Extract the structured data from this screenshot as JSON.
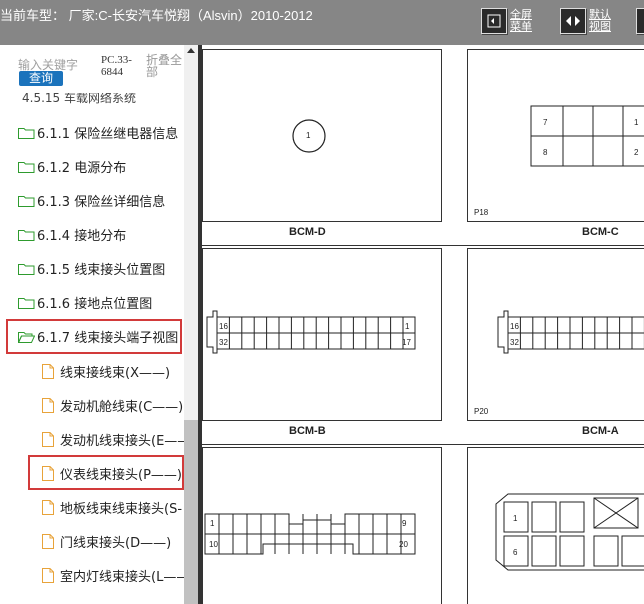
{
  "header": {
    "title": "当前车型：  厂家:C-长安汽车悦翔（Alsvin）2010-2012",
    "fullscreen_label": "全屏菜单",
    "default_view_label": "默认视图"
  },
  "sidebar": {
    "keyword_placeholder": "输入关键字",
    "query_button": "查询",
    "pc_code": "PC.33-6844",
    "collapse_all": "折叠全部",
    "partial_item": "4.5.15 车载网络系统",
    "tree": [
      {
        "label": "6.1.1 保险丝继电器信息",
        "type": "folder"
      },
      {
        "label": "6.1.2 电源分布",
        "type": "folder"
      },
      {
        "label": "6.1.3 保险丝详细信息",
        "type": "folder"
      },
      {
        "label": "6.1.4 接地分布",
        "type": "folder"
      },
      {
        "label": "6.1.5 线束接头位置图",
        "type": "folder"
      },
      {
        "label": "6.1.6 接地点位置图",
        "type": "folder"
      },
      {
        "label": "6.1.7 线束接头端子视图",
        "type": "folder-open",
        "highlighted": true
      }
    ],
    "children": [
      {
        "label": "线束接线束(X——)"
      },
      {
        "label": "发动机舱线束(C——)"
      },
      {
        "label": "发动机线束接头(E——"
      },
      {
        "label": "仪表线束接头(P——)",
        "highlighted": true
      },
      {
        "label": "地板线束线束接头(S-"
      },
      {
        "label": "门线束接头(D——)"
      },
      {
        "label": "室内灯线束接头(L——"
      }
    ]
  },
  "viewer": {
    "panels": [
      {
        "label": "BCM-D",
        "tag": ""
      },
      {
        "label": "BCM-C",
        "tag": "P18"
      },
      {
        "label": "BCM-B",
        "tag": ""
      },
      {
        "label": "BCM-A",
        "tag": "P20"
      }
    ],
    "pins": {
      "bcmd_circle": "1",
      "bcmc_top_left": "7",
      "bcmc_top_right": "1",
      "bcmc_bot_left": "8",
      "bcmc_bot_right": "2",
      "bcmb_tl": "16",
      "bcmb_bl": "32",
      "bcmb_tr": "1",
      "bcmb_br": "17",
      "bcma_tl": "16",
      "bcma_bl": "32",
      "c5_tl": "1",
      "c5_bl": "10",
      "c5_tr": "9",
      "c5_br": "20",
      "c6_t": "1",
      "c6_b": "6"
    }
  },
  "colors": {
    "topbar": "#868686",
    "highlight": "#d23a3a",
    "query_button": "#1b73bc",
    "folder": "#2e9b2e",
    "doc": "#e8a33a"
  }
}
